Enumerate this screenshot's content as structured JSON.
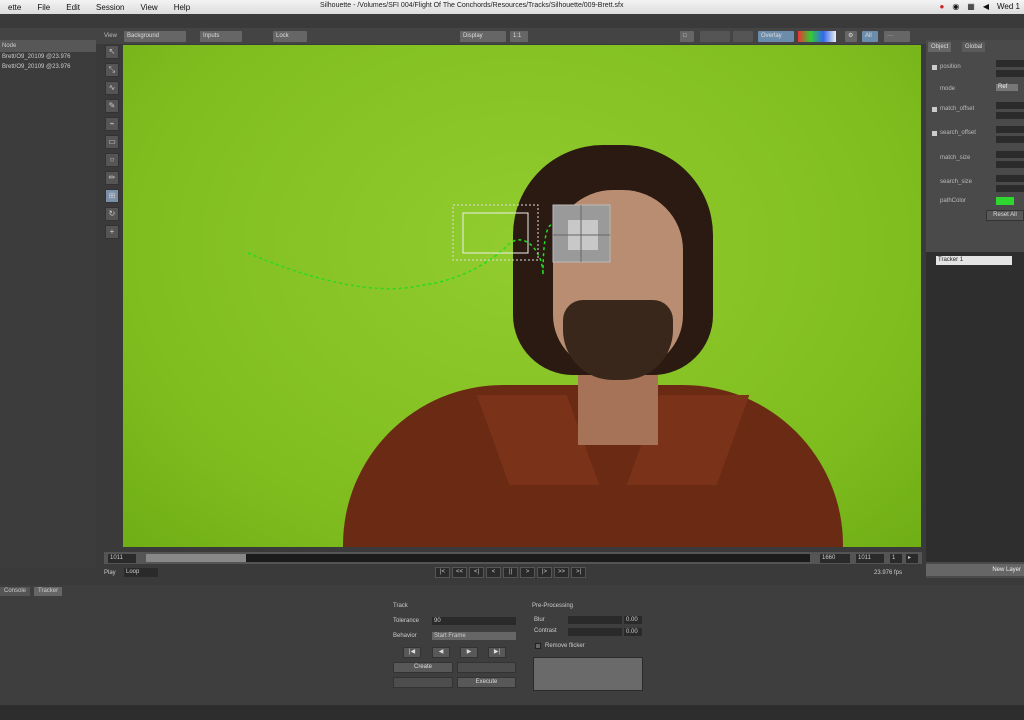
{
  "menubar": {
    "items": [
      "ette",
      "File",
      "Edit",
      "Session",
      "View",
      "Help"
    ],
    "title": "Silhouette - /Volumes/SFI 004/Flight Of The Conchords/Resources/Tracks/Silhouette/009-Brett.sfx",
    "clock": "Wed 1"
  },
  "toolbar": {
    "view_label": "View",
    "view_value": "Background",
    "inputs_label": "Inputs",
    "lock_label": "Lock",
    "display_label": "Display",
    "zoom_value": "1:1",
    "overlay_label": "Overlay",
    "all_label": "All"
  },
  "leftpanel": {
    "header": "Node",
    "rows": [
      "Brett/O9_20109 @23.976",
      "Brett/O9_20109 @23.976"
    ]
  },
  "timeline": {
    "start_value": "1011",
    "end_value": "1660",
    "current_frame": "1011",
    "progress": 0.15,
    "fps": "23.976 fps",
    "play_label": "Play",
    "play_value": "Loop",
    "transport": [
      "|<",
      "<<",
      "<|",
      "<",
      "||",
      ">",
      "|>",
      ">>",
      ">|"
    ]
  },
  "rightpanel": {
    "tabs": [
      "Object",
      "Global"
    ],
    "props": [
      "position",
      "mode",
      "match_offset",
      "search_offset",
      "match_size",
      "search_size",
      "pathColor"
    ],
    "mode_value": "Ref",
    "reset_label": "Reset All",
    "tracker_item": "Tracker 1",
    "new_layer": "New Layer",
    "path_color": "#2fd62f"
  },
  "bottom": {
    "tabs": [
      "Console",
      "Tracker"
    ],
    "track_title": "Track",
    "tolerance_label": "Tolerance",
    "tolerance_value": "90",
    "behavior_label": "Behavior",
    "behavior_value": "Start Frame",
    "create_label": "Create",
    "execute_label": "Execute",
    "preproc_title": "Pre-Processing",
    "blur_label": "Blur",
    "blur_value": "0.00",
    "contrast_label": "Contrast",
    "contrast_value": "0.00",
    "remove_flicker_label": "Remove flicker"
  }
}
